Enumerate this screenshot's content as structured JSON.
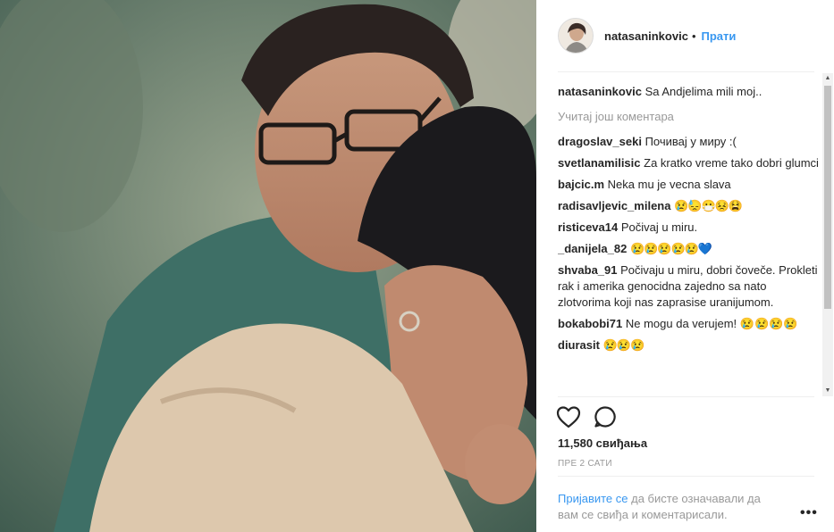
{
  "post": {
    "username": "natasaninkovic",
    "dot": "•",
    "follow_label": "Прати",
    "caption": {
      "user": "natasaninkovic",
      "text": "Sa Andjelima mili moj.."
    },
    "load_more_label": "Учитај још коментара",
    "comments": [
      {
        "user": "dragoslav_seki",
        "text": "Почивај у миру :("
      },
      {
        "user": "svetlanamilisic",
        "text": "Za kratko vreme tako dobri glumci"
      },
      {
        "user": "bajcic.m",
        "text": "Neka mu je vecna slava"
      },
      {
        "user": "radisavljevic_milena",
        "text": "😢😓😷😣😫"
      },
      {
        "user": "risticeva14",
        "text": "Počivaj u miru."
      },
      {
        "user": "_danijela_82",
        "text": "😢😢😢😢😢💙"
      },
      {
        "user": "shvaba_91",
        "text": "Počivaju u miru, dobri čoveče. Prokleti rak i amerika genocidna zajedno sa nato zlotvorima koji nas zaprasise uranijumom."
      },
      {
        "user": "bokabobi71",
        "text": "Ne mogu da verujem! 😢😢😢😢"
      },
      {
        "user": "diurasit",
        "text": "😢😢😢"
      }
    ],
    "likes": "11,580 свиђања",
    "time": "ПРЕ 2 САТИ",
    "footer": {
      "login": "Пријавите се",
      "rest": " да бисте означавали да вам се свиђа и коментарисали."
    },
    "more_label": "•••"
  },
  "icons": {
    "like": "heart-outline-icon",
    "comment": "speech-bubble-icon",
    "scroll_up": "▲",
    "scroll_down": "▼"
  }
}
